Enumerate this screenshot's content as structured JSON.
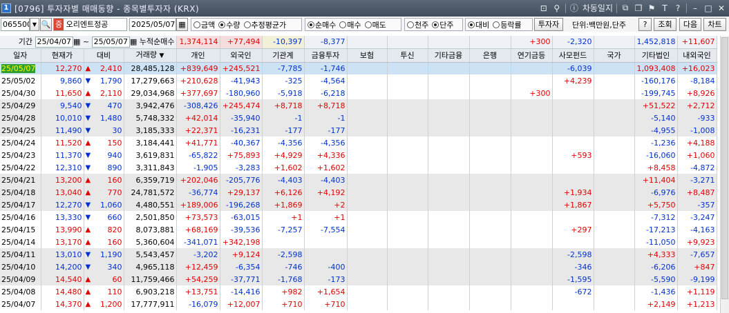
{
  "window": {
    "number": "1",
    "title": "[0796] 투자자별 매매동향 - 종목별투자자 (KRX)",
    "right_label": "차동일지"
  },
  "toolbar": {
    "code": "065500",
    "badge": "중",
    "stock_name": "오리엔트정공",
    "date": "2025/05/07",
    "radios_a": [
      {
        "label": "금액",
        "on": false
      },
      {
        "label": "수량",
        "on": true
      },
      {
        "label": "추정평균가",
        "on": false
      }
    ],
    "radios_b": [
      {
        "label": "순매수",
        "on": true
      },
      {
        "label": "매수",
        "on": false
      },
      {
        "label": "매도",
        "on": false
      }
    ],
    "radios_c": [
      {
        "label": "천주",
        "on": false
      },
      {
        "label": "단주",
        "on": true
      }
    ],
    "radios_d": [
      {
        "label": "대비",
        "on": true
      },
      {
        "label": "등락률",
        "on": false
      }
    ],
    "investor_btn": "투자자",
    "unit_label": "단위:백만원,단주",
    "help_btn": "?",
    "query_btn": "조회",
    "next_btn": "다음",
    "chart_btn": "차트"
  },
  "summary": {
    "period_label": "기간",
    "from": "25/04/07",
    "tilde": "~",
    "to": "25/05/07",
    "cum_label": "누적순매수",
    "individual": "1,374,114",
    "foreign": "+77,494",
    "institution": "-10,397",
    "financial": "-8,377",
    "pension": "+300",
    "private": "-2,320",
    "other_corp": "1,452,818",
    "dom_foreign": "+11,607"
  },
  "headers": [
    "일자",
    "현재가",
    "대비",
    "거래량",
    "개인",
    "외국인",
    "기관계",
    "금융투자",
    "보험",
    "투신",
    "기타금융",
    "은행",
    "연기금등",
    "사모펀드",
    "국가",
    "기타법인",
    "내외국인"
  ],
  "rows": [
    {
      "d": "25/05/07",
      "p": "12,270",
      "dir": "up",
      "c": "2,410",
      "v": "28,485,128",
      "ind": "+839,649",
      "frg": "+245,521",
      "inst": "-7,785",
      "fin": "-1,746",
      "pen": "",
      "pri": "-6,039",
      "oth": "1,093,408",
      "dom": "+16,023"
    },
    {
      "d": "25/05/02",
      "p": "9,860",
      "dir": "dn",
      "c": "1,790",
      "v": "17,279,663",
      "ind": "+210,628",
      "frg": "-41,943",
      "inst": "-325",
      "fin": "-4,564",
      "pen": "",
      "pri": "+4,239",
      "oth": "-160,176",
      "dom": "-8,184"
    },
    {
      "d": "25/04/30",
      "p": "11,650",
      "dir": "up",
      "c": "2,110",
      "v": "29,034,968",
      "ind": "+377,697",
      "frg": "-180,960",
      "inst": "-5,918",
      "fin": "-6,218",
      "pen": "+300",
      "pri": "",
      "oth": "-199,745",
      "dom": "+8,926"
    },
    {
      "d": "25/04/29",
      "p": "9,540",
      "dir": "dn",
      "c": "470",
      "v": "3,942,476",
      "ind": "-308,426",
      "frg": "+245,474",
      "inst": "+8,718",
      "fin": "+8,718",
      "pen": "",
      "pri": "",
      "oth": "+51,522",
      "dom": "+2,712"
    },
    {
      "d": "25/04/28",
      "p": "10,010",
      "dir": "dn",
      "c": "1,480",
      "v": "5,748,332",
      "ind": "+42,014",
      "frg": "-35,940",
      "inst": "-1",
      "fin": "-1",
      "pen": "",
      "pri": "",
      "oth": "-5,140",
      "dom": "-933"
    },
    {
      "d": "25/04/25",
      "p": "11,490",
      "dir": "dn",
      "c": "30",
      "v": "3,185,333",
      "ind": "+22,371",
      "frg": "-16,231",
      "inst": "-177",
      "fin": "-177",
      "pen": "",
      "pri": "",
      "oth": "-4,955",
      "dom": "-1,008"
    },
    {
      "d": "25/04/24",
      "p": "11,520",
      "dir": "up",
      "c": "150",
      "v": "3,184,441",
      "ind": "+41,771",
      "frg": "-40,367",
      "inst": "-4,356",
      "fin": "-4,356",
      "pen": "",
      "pri": "",
      "oth": "-1,236",
      "dom": "+4,188"
    },
    {
      "d": "25/04/23",
      "p": "11,370",
      "dir": "dn",
      "c": "940",
      "v": "3,619,831",
      "ind": "-65,822",
      "frg": "+75,893",
      "inst": "+4,929",
      "fin": "+4,336",
      "pen": "",
      "pri": "+593",
      "oth": "-16,060",
      "dom": "+1,060"
    },
    {
      "d": "25/04/22",
      "p": "12,310",
      "dir": "dn",
      "c": "890",
      "v": "3,311,843",
      "ind": "-1,905",
      "frg": "-3,283",
      "inst": "+1,602",
      "fin": "+1,602",
      "pen": "",
      "pri": "",
      "oth": "+8,458",
      "dom": "-4,872"
    },
    {
      "d": "25/04/21",
      "p": "13,200",
      "dir": "up",
      "c": "160",
      "v": "6,359,719",
      "ind": "+202,046",
      "frg": "-205,776",
      "inst": "-4,403",
      "fin": "-4,403",
      "pen": "",
      "pri": "",
      "oth": "+11,404",
      "dom": "-3,271"
    },
    {
      "d": "25/04/18",
      "p": "13,040",
      "dir": "up",
      "c": "770",
      "v": "24,781,572",
      "ind": "-36,774",
      "frg": "+29,137",
      "inst": "+6,126",
      "fin": "+4,192",
      "pen": "",
      "pri": "+1,934",
      "oth": "-6,976",
      "dom": "+8,487"
    },
    {
      "d": "25/04/17",
      "p": "12,270",
      "dir": "dn",
      "c": "1,060",
      "v": "4,480,551",
      "ind": "+189,006",
      "frg": "-196,268",
      "inst": "+1,869",
      "fin": "+2",
      "pen": "",
      "pri": "+1,867",
      "oth": "+5,750",
      "dom": "-357"
    },
    {
      "d": "25/04/16",
      "p": "13,330",
      "dir": "dn",
      "c": "660",
      "v": "2,501,850",
      "ind": "+73,573",
      "frg": "-63,015",
      "inst": "+1",
      "fin": "+1",
      "pen": "",
      "pri": "",
      "oth": "-7,312",
      "dom": "-3,247"
    },
    {
      "d": "25/04/15",
      "p": "13,990",
      "dir": "up",
      "c": "820",
      "v": "8,073,881",
      "ind": "+68,169",
      "frg": "-39,536",
      "inst": "-7,257",
      "fin": "-7,554",
      "pen": "",
      "pri": "+297",
      "oth": "-17,213",
      "dom": "-4,163"
    },
    {
      "d": "25/04/14",
      "p": "13,170",
      "dir": "up",
      "c": "160",
      "v": "5,360,604",
      "ind": "-341,071",
      "frg": "+342,198",
      "inst": "",
      "fin": "",
      "pen": "",
      "pri": "",
      "oth": "-11,050",
      "dom": "+9,923"
    },
    {
      "d": "25/04/11",
      "p": "13,010",
      "dir": "dn",
      "c": "1,190",
      "v": "5,543,457",
      "ind": "-3,202",
      "frg": "+9,124",
      "inst": "-2,598",
      "fin": "",
      "pen": "",
      "pri": "-2,598",
      "oth": "+4,333",
      "dom": "-7,657"
    },
    {
      "d": "25/04/10",
      "p": "14,200",
      "dir": "dn",
      "c": "340",
      "v": "4,965,118",
      "ind": "+12,459",
      "frg": "-6,354",
      "inst": "-746",
      "fin": "-400",
      "pen": "",
      "pri": "-346",
      "oth": "-6,206",
      "dom": "+847"
    },
    {
      "d": "25/04/09",
      "p": "14,540",
      "dir": "up",
      "c": "60",
      "v": "11,759,466",
      "ind": "+54,259",
      "frg": "-37,771",
      "inst": "-1,768",
      "fin": "-173",
      "pen": "",
      "pri": "-1,595",
      "oth": "-5,590",
      "dom": "-9,199"
    },
    {
      "d": "25/04/08",
      "p": "14,480",
      "dir": "up",
      "c": "110",
      "v": "6,903,218",
      "ind": "+13,751",
      "frg": "-14,416",
      "inst": "+982",
      "fin": "+1,654",
      "pen": "",
      "pri": "-672",
      "oth": "-1,436",
      "dom": "+1,119"
    },
    {
      "d": "25/04/07",
      "p": "14,370",
      "dir": "up",
      "c": "1,200",
      "v": "17,777,911",
      "ind": "-16,079",
      "frg": "+12,007",
      "inst": "+710",
      "fin": "+710",
      "pen": "",
      "pri": "",
      "oth": "+2,149",
      "dom": "+1,213"
    }
  ],
  "colors": {
    "up": "#e00000",
    "down": "#0030d0",
    "selected_date_bg": "#2e9e2e"
  }
}
